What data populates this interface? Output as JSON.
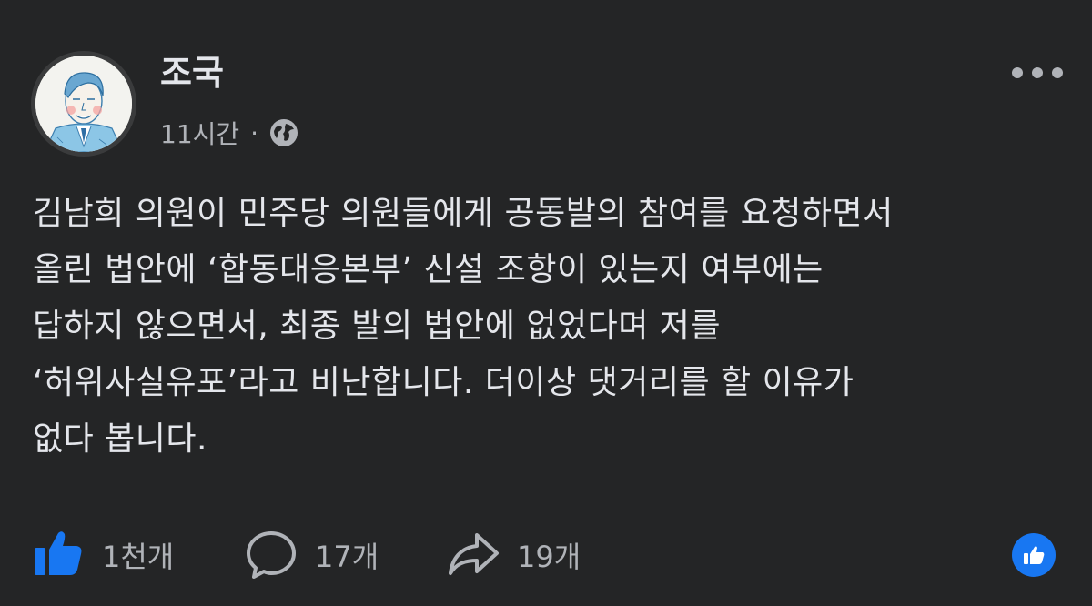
{
  "post": {
    "author": "조국",
    "time": "11시간",
    "separator": "·",
    "privacy_icon": "globe-icon",
    "more_icon": "more-options-icon",
    "text": "김남희 의원이 민주당 의원들에게 공동발의 참여를 요청하면서\n올린 법안에 ‘합동대응본부’ 신설 조항이 있는지 여부에는\n답하지 않으면서, 최종 발의 법안에 없었다며 저를\n‘허위사실유포’라고 비난합니다. 더이상 댓거리를 할 이유가\n없다 봅니다."
  },
  "actions": {
    "like": {
      "icon": "thumbs-up-icon",
      "count": "1천개"
    },
    "comment": {
      "icon": "comment-bubble-icon",
      "count": "17개"
    },
    "share": {
      "icon": "share-arrow-icon",
      "count": "19개"
    }
  },
  "reaction_badge": {
    "icon": "like-reaction-icon"
  },
  "colors": {
    "background": "#242526",
    "text_primary": "#e4e6eb",
    "text_secondary": "#b0b3b8",
    "like_blue": "#1877f2"
  }
}
